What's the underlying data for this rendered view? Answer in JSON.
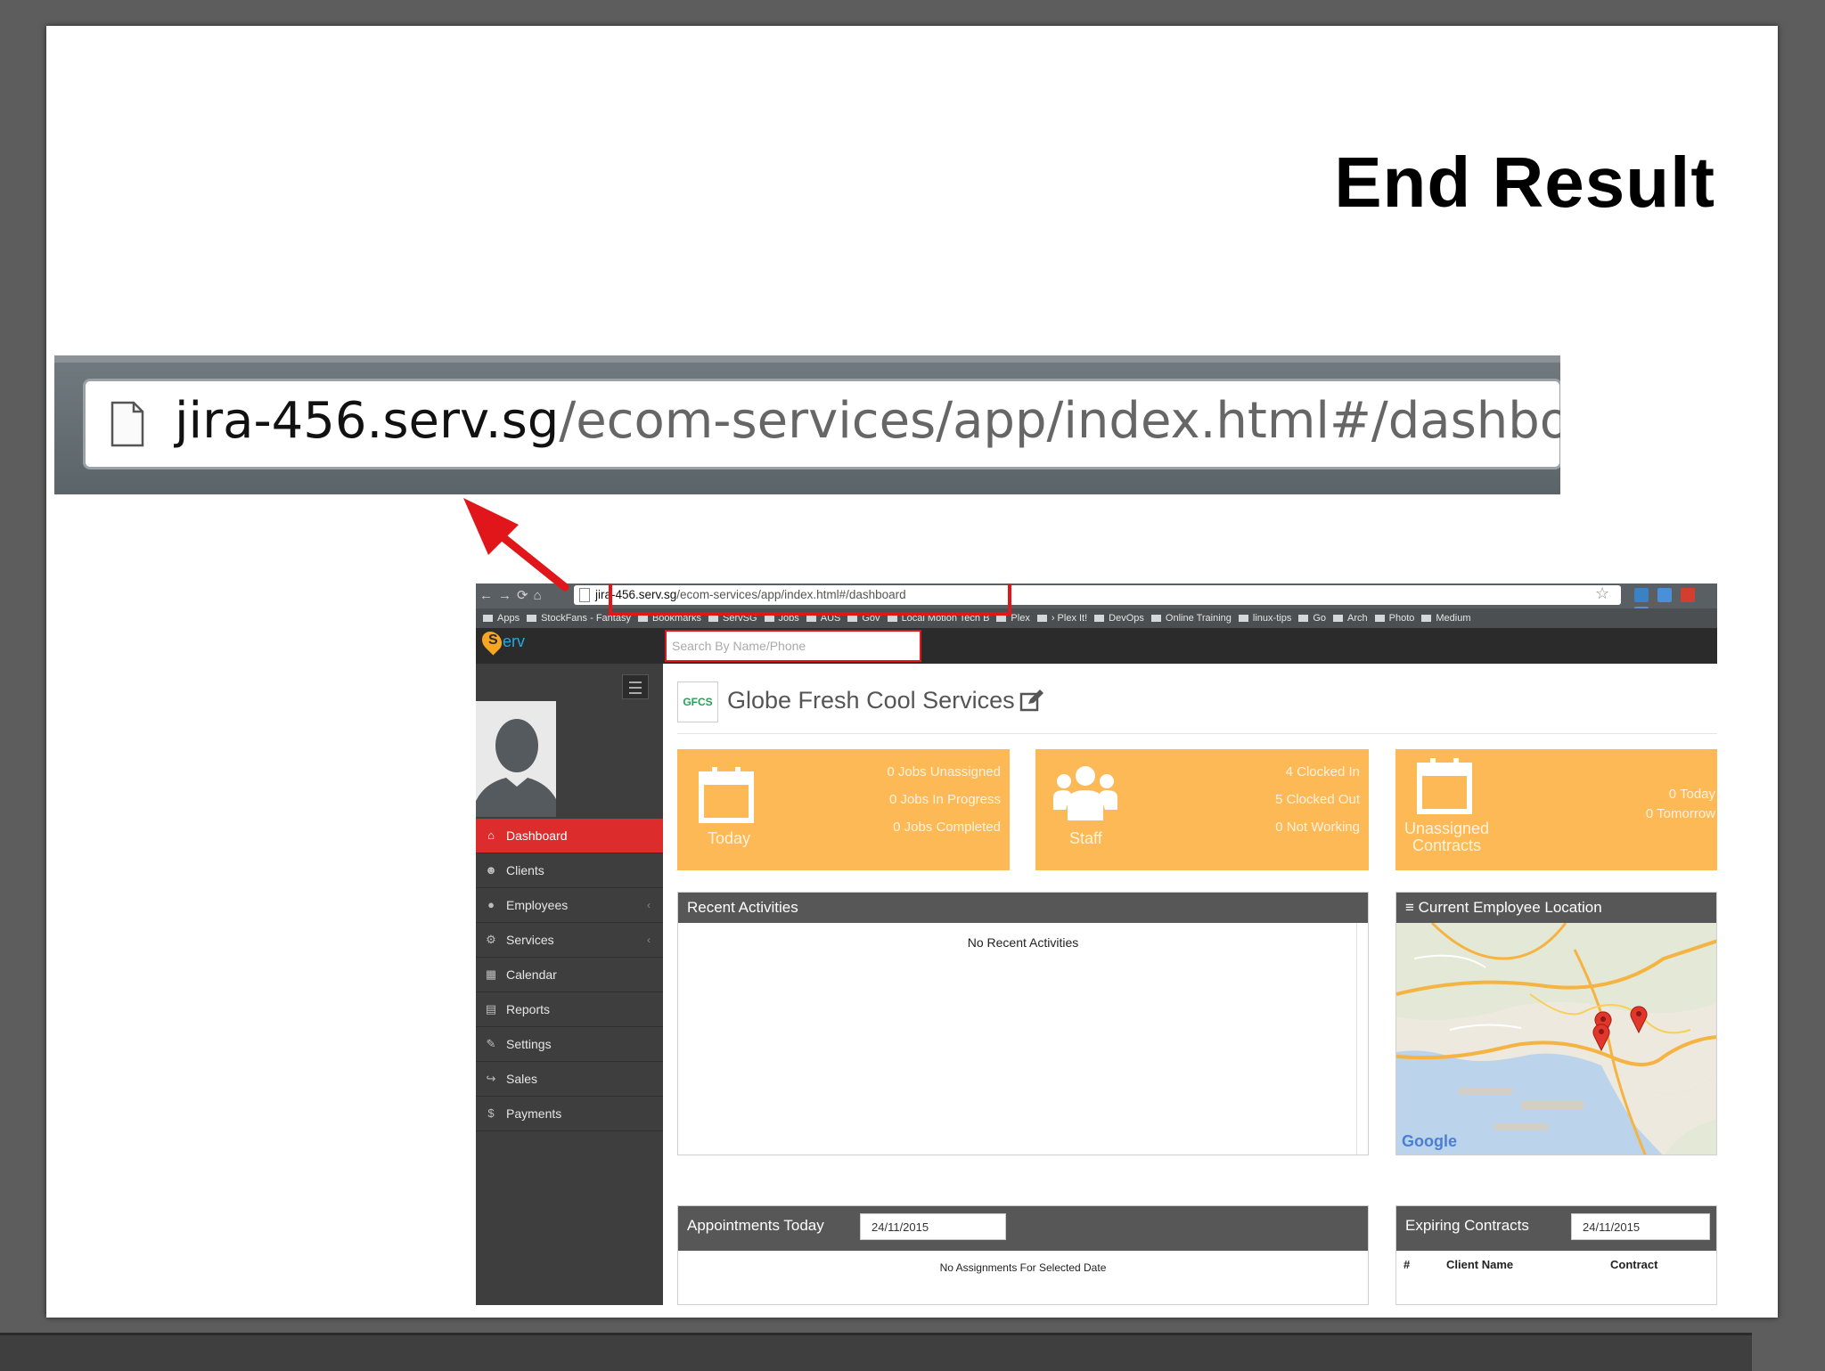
{
  "slide": {
    "title": "End Result"
  },
  "zoomed_url": {
    "host": "jira-456.serv.sg",
    "path": "/ecom-services/app/index.html#/dashboard"
  },
  "browser": {
    "url_host": "jira-456.serv.sg",
    "url_path": "/ecom-services/app/index.html#/dashboard",
    "bookmarks": [
      "Apps",
      "StockFans - Fantasy",
      "Bookmarks",
      "ServSG",
      "Jobs",
      "AUS",
      "Gov",
      "Local Motion Tech B",
      "Plex",
      "› Plex It!",
      "DevOps",
      "Online Training",
      "linux-tips",
      "Go",
      "Arch",
      "Photo",
      "Medium"
    ]
  },
  "app": {
    "logo_s": "S",
    "logo_text": "erv",
    "search_placeholder": "Search By Name/Phone",
    "nav": [
      {
        "label": "Dashboard",
        "icon": "home-icon",
        "active": true
      },
      {
        "label": "Clients",
        "icon": "users-icon"
      },
      {
        "label": "Employees",
        "icon": "user-icon",
        "chevron": "‹"
      },
      {
        "label": "Services",
        "icon": "cogs-icon",
        "chevron": "‹"
      },
      {
        "label": "Calendar",
        "icon": "calendar-icon"
      },
      {
        "label": "Reports",
        "icon": "file-icon"
      },
      {
        "label": "Settings",
        "icon": "wrench-icon"
      },
      {
        "label": "Sales",
        "icon": "share-icon"
      },
      {
        "label": "Payments",
        "icon": "dollar-icon"
      }
    ],
    "company": {
      "logo_text": "GFCS",
      "name": "Globe Fresh Cool Services"
    },
    "tiles": {
      "today": {
        "caption": "Today",
        "stats": [
          "0 Jobs Unassigned",
          "0 Jobs In Progress",
          "0 Jobs Completed"
        ]
      },
      "staff": {
        "caption": "Staff",
        "stats": [
          "4 Clocked In",
          "5 Clocked Out",
          "0 Not Working"
        ]
      },
      "contracts": {
        "caption_line1": "Unassigned",
        "caption_line2": "Contracts",
        "stats": [
          "0 Today",
          "0 Tomorrow"
        ]
      }
    },
    "recent": {
      "title": "Recent Activities",
      "empty": "No Recent Activities"
    },
    "location": {
      "title": "Current Employee Location",
      "map_brand": "Google"
    },
    "appointments": {
      "title": "Appointments Today",
      "date": "24/11/2015",
      "empty": "No Assignments For Selected Date"
    },
    "expiring": {
      "title": "Expiring Contracts",
      "date": "24/11/2015",
      "columns": [
        "#",
        "Client Name",
        "Contract"
      ]
    }
  },
  "colors": {
    "accent_red": "#dd2c2c",
    "tile_orange": "#fdb955",
    "sidebar": "#3e3e3e",
    "header": "#2b2b2b"
  }
}
